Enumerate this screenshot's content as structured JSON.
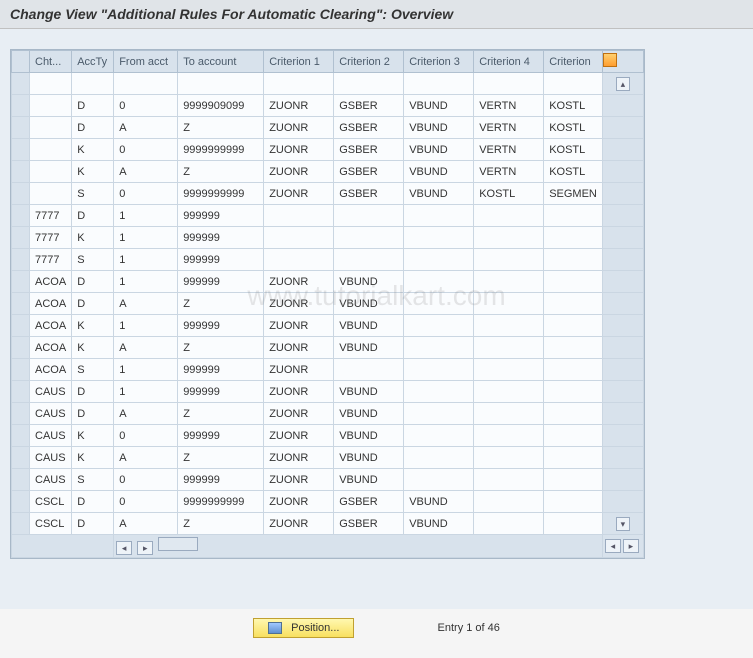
{
  "header": {
    "title": "Change View \"Additional Rules For Automatic Clearing\": Overview"
  },
  "watermark": "www.tutorialkart.com",
  "table": {
    "columns": [
      "Cht...",
      "AccTy",
      "From acct",
      "To account",
      "Criterion 1",
      "Criterion 2",
      "Criterion 3",
      "Criterion 4",
      "Criterion"
    ],
    "rows": [
      {
        "cht": "",
        "accty": "",
        "from": "",
        "to": "",
        "c1": "",
        "c2": "",
        "c3": "",
        "c4": "",
        "c5": ""
      },
      {
        "cht": "",
        "accty": "D",
        "from": "0",
        "to": "9999909099",
        "c1": "ZUONR",
        "c2": "GSBER",
        "c3": "VBUND",
        "c4": "VERTN",
        "c5": "KOSTL"
      },
      {
        "cht": "",
        "accty": "D",
        "from": "A",
        "to": "Z",
        "c1": "ZUONR",
        "c2": "GSBER",
        "c3": "VBUND",
        "c4": "VERTN",
        "c5": "KOSTL"
      },
      {
        "cht": "",
        "accty": "K",
        "from": "0",
        "to": "9999999999",
        "c1": "ZUONR",
        "c2": "GSBER",
        "c3": "VBUND",
        "c4": "VERTN",
        "c5": "KOSTL"
      },
      {
        "cht": "",
        "accty": "K",
        "from": "A",
        "to": "Z",
        "c1": "ZUONR",
        "c2": "GSBER",
        "c3": "VBUND",
        "c4": "VERTN",
        "c5": "KOSTL"
      },
      {
        "cht": "",
        "accty": "S",
        "from": "0",
        "to": "9999999999",
        "c1": "ZUONR",
        "c2": "GSBER",
        "c3": "VBUND",
        "c4": "KOSTL",
        "c5": "SEGMEN"
      },
      {
        "cht": "7777",
        "accty": "D",
        "from": "1",
        "to": "999999",
        "c1": "",
        "c2": "",
        "c3": "",
        "c4": "",
        "c5": ""
      },
      {
        "cht": "7777",
        "accty": "K",
        "from": "1",
        "to": "999999",
        "c1": "",
        "c2": "",
        "c3": "",
        "c4": "",
        "c5": ""
      },
      {
        "cht": "7777",
        "accty": "S",
        "from": "1",
        "to": "999999",
        "c1": "",
        "c2": "",
        "c3": "",
        "c4": "",
        "c5": ""
      },
      {
        "cht": "ACOA",
        "accty": "D",
        "from": "1",
        "to": "999999",
        "c1": "ZUONR",
        "c2": "VBUND",
        "c3": "",
        "c4": "",
        "c5": ""
      },
      {
        "cht": "ACOA",
        "accty": "D",
        "from": "A",
        "to": "Z",
        "c1": "ZUONR",
        "c2": "VBUND",
        "c3": "",
        "c4": "",
        "c5": ""
      },
      {
        "cht": "ACOA",
        "accty": "K",
        "from": "1",
        "to": "999999",
        "c1": "ZUONR",
        "c2": "VBUND",
        "c3": "",
        "c4": "",
        "c5": ""
      },
      {
        "cht": "ACOA",
        "accty": "K",
        "from": "A",
        "to": "Z",
        "c1": "ZUONR",
        "c2": "VBUND",
        "c3": "",
        "c4": "",
        "c5": ""
      },
      {
        "cht": "ACOA",
        "accty": "S",
        "from": "1",
        "to": "999999",
        "c1": "ZUONR",
        "c2": "",
        "c3": "",
        "c4": "",
        "c5": ""
      },
      {
        "cht": "CAUS",
        "accty": "D",
        "from": "1",
        "to": "999999",
        "c1": "ZUONR",
        "c2": "VBUND",
        "c3": "",
        "c4": "",
        "c5": ""
      },
      {
        "cht": "CAUS",
        "accty": "D",
        "from": "A",
        "to": "Z",
        "c1": "ZUONR",
        "c2": "VBUND",
        "c3": "",
        "c4": "",
        "c5": ""
      },
      {
        "cht": "CAUS",
        "accty": "K",
        "from": "0",
        "to": "999999",
        "c1": "ZUONR",
        "c2": "VBUND",
        "c3": "",
        "c4": "",
        "c5": ""
      },
      {
        "cht": "CAUS",
        "accty": "K",
        "from": "A",
        "to": "Z",
        "c1": "ZUONR",
        "c2": "VBUND",
        "c3": "",
        "c4": "",
        "c5": ""
      },
      {
        "cht": "CAUS",
        "accty": "S",
        "from": "0",
        "to": "999999",
        "c1": "ZUONR",
        "c2": "VBUND",
        "c3": "",
        "c4": "",
        "c5": ""
      },
      {
        "cht": "CSCL",
        "accty": "D",
        "from": "0",
        "to": "9999999999",
        "c1": "ZUONR",
        "c2": "GSBER",
        "c3": "VBUND",
        "c4": "",
        "c5": ""
      },
      {
        "cht": "CSCL",
        "accty": "D",
        "from": "A",
        "to": "Z",
        "c1": "ZUONR",
        "c2": "GSBER",
        "c3": "VBUND",
        "c4": "",
        "c5": ""
      }
    ]
  },
  "footer": {
    "position_label": "Position...",
    "entry_info": "Entry 1 of 46"
  }
}
